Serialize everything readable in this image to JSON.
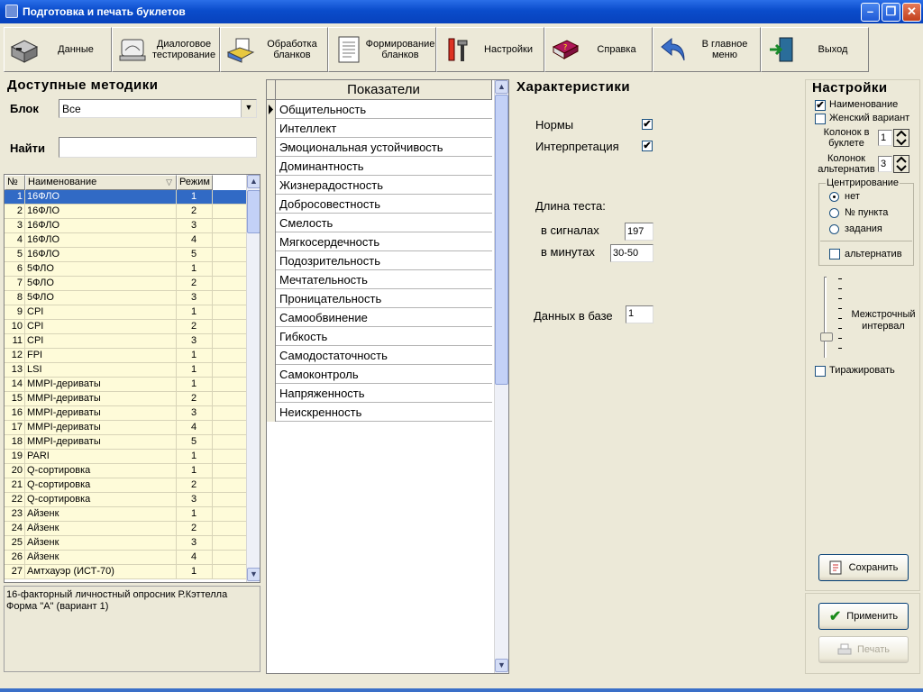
{
  "window": {
    "title": "Подготовка и печать буклетов"
  },
  "toolbar": {
    "buttons": [
      {
        "label": "Данные"
      },
      {
        "label": "Диалоговое\nтестирование"
      },
      {
        "label": "Обработка\nбланков"
      },
      {
        "label": "Формирование\nбланков"
      },
      {
        "label": "Настройки"
      },
      {
        "label": "Справка"
      },
      {
        "label": "В главное\nменю"
      },
      {
        "label": "Выход"
      }
    ]
  },
  "methods": {
    "title": "Доступные методики",
    "block_label": "Блок",
    "block_value": "Все",
    "search_label": "Найти",
    "search_value": "",
    "columns": {
      "num": "№",
      "name": "Наименование",
      "mode": "Режим"
    },
    "rows": [
      {
        "n": "1",
        "name": "16ФЛО",
        "mode": "1"
      },
      {
        "n": "2",
        "name": "16ФЛО",
        "mode": "2"
      },
      {
        "n": "3",
        "name": "16ФЛО",
        "mode": "3"
      },
      {
        "n": "4",
        "name": "16ФЛО",
        "mode": "4"
      },
      {
        "n": "5",
        "name": "16ФЛО",
        "mode": "5"
      },
      {
        "n": "6",
        "name": "5ФЛО",
        "mode": "1"
      },
      {
        "n": "7",
        "name": "5ФЛО",
        "mode": "2"
      },
      {
        "n": "8",
        "name": "5ФЛО",
        "mode": "3"
      },
      {
        "n": "9",
        "name": "CPI",
        "mode": "1"
      },
      {
        "n": "10",
        "name": "CPI",
        "mode": "2"
      },
      {
        "n": "11",
        "name": "CPI",
        "mode": "3"
      },
      {
        "n": "12",
        "name": "FPI",
        "mode": "1"
      },
      {
        "n": "13",
        "name": "LSI",
        "mode": "1"
      },
      {
        "n": "14",
        "name": "MMPI-дериваты",
        "mode": "1"
      },
      {
        "n": "15",
        "name": "MMPI-дериваты",
        "mode": "2"
      },
      {
        "n": "16",
        "name": "MMPI-дериваты",
        "mode": "3"
      },
      {
        "n": "17",
        "name": "MMPI-дериваты",
        "mode": "4"
      },
      {
        "n": "18",
        "name": "MMPI-дериваты",
        "mode": "5"
      },
      {
        "n": "19",
        "name": "PARI",
        "mode": "1"
      },
      {
        "n": "20",
        "name": "Q-сортировка",
        "mode": "1"
      },
      {
        "n": "21",
        "name": "Q-сортировка",
        "mode": "2"
      },
      {
        "n": "22",
        "name": "Q-сортировка",
        "mode": "3"
      },
      {
        "n": "23",
        "name": "Айзенк",
        "mode": "1"
      },
      {
        "n": "24",
        "name": "Айзенк",
        "mode": "2"
      },
      {
        "n": "25",
        "name": "Айзенк",
        "mode": "3"
      },
      {
        "n": "26",
        "name": "Айзенк",
        "mode": "4"
      },
      {
        "n": "27",
        "name": "Амтхауэр (ИСТ-70)",
        "mode": "1"
      }
    ],
    "description_line1": "16-факторный личностный опросник Р.Кэттелла",
    "description_line2": "Форма \"A\" (вариант 1)"
  },
  "indicators": {
    "title": "Показатели",
    "items": [
      "Общительность",
      "Интеллект",
      "Эмоциональная устойчивость",
      "Доминантность",
      "Жизнерадостность",
      "Добросовестность",
      "Смелость",
      "Мягкосердечность",
      "Подозрительность",
      "Мечтательность",
      "Проницательность",
      "Самообвинение",
      "Гибкость",
      "Самодостаточность",
      "Самоконтроль",
      "Напряженность",
      "Неискренность"
    ]
  },
  "characteristics": {
    "title": "Характеристики",
    "norms_label": "Нормы",
    "norms_checked": "✔",
    "interp_label": "Интерпретация",
    "interp_checked": "✔",
    "length_label": "Длина теста:",
    "signals_label": "в сигналах",
    "signals_value": "197",
    "minutes_label": "в минутах",
    "minutes_value": "30-50",
    "db_label": "Данных в базе",
    "db_value": "1"
  },
  "settings": {
    "title": "Настройки",
    "name_label": "Наименование",
    "name_checked": "✔",
    "female_label": "Женский вариант",
    "female_checked": "",
    "cols_booklet_label": "Колонок в\nбуклете",
    "cols_booklet_value": "1",
    "cols_alt_label": "Колонок\nальтернатив",
    "cols_alt_value": "3",
    "centering_title": "Центрирование",
    "center_none": "нет",
    "center_item": "№ пункта",
    "center_task": "задания",
    "alternatives_label": "альтернатив",
    "line_spacing_label": "Межстрочный\nинтервал",
    "replicate_label": "Тиражировать",
    "save_label": "Сохранить",
    "apply_label": "Применить",
    "print_label": "Печать"
  }
}
